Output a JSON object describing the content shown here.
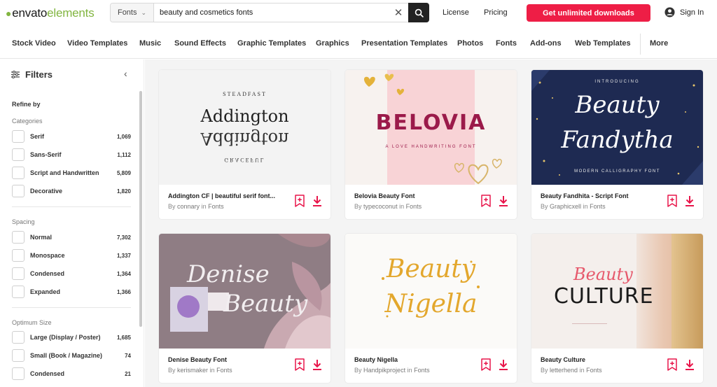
{
  "header": {
    "logo_part1": "envato",
    "logo_part2": "elements",
    "search": {
      "category": "Fonts",
      "value": "beauty and cosmetics fonts",
      "placeholder": "Search"
    },
    "links": [
      "License",
      "Pricing"
    ],
    "cta": "Get unlimited downloads",
    "signin": "Sign In"
  },
  "categories": [
    "Stock Video",
    "Video Templates",
    "Music",
    "Sound Effects",
    "Graphic Templates",
    "Graphics",
    "Presentation Templates",
    "Photos",
    "Fonts",
    "Add-ons",
    "Web Templates",
    "More"
  ],
  "sidebar": {
    "title": "Filters",
    "refine": "Refine by",
    "sections": [
      {
        "title": "Categories",
        "items": [
          {
            "label": "Serif",
            "count": "1,069"
          },
          {
            "label": "Sans-Serif",
            "count": "1,112"
          },
          {
            "label": "Script and Handwritten",
            "count": "5,809"
          },
          {
            "label": "Decorative",
            "count": "1,820"
          }
        ]
      },
      {
        "title": "Spacing",
        "items": [
          {
            "label": "Normal",
            "count": "7,302"
          },
          {
            "label": "Monospace",
            "count": "1,337"
          },
          {
            "label": "Condensed",
            "count": "1,364"
          },
          {
            "label": "Expanded",
            "count": "1,366"
          }
        ]
      },
      {
        "title": "Optimum Size",
        "items": [
          {
            "label": "Large (Display / Poster)",
            "count": "1,685"
          },
          {
            "label": "Small (Book / Magazine)",
            "count": "74"
          },
          {
            "label": "Condensed",
            "count": "21"
          }
        ]
      }
    ]
  },
  "cards": [
    {
      "title": "Addington CF | beautiful serif font...",
      "by_prefix": "By",
      "author": "connary",
      "in_word": "in",
      "category": "Fonts",
      "preview": {
        "top": "STEADFAST",
        "main": "Addington",
        "bottom": "GRACEFUL"
      }
    },
    {
      "title": "Belovia Beauty Font",
      "by_prefix": "By",
      "author": "typecoconut",
      "in_word": "in",
      "category": "Fonts",
      "preview": {
        "main": "BELOVIA",
        "sub": "A LOVE HANDWRITING FONT"
      }
    },
    {
      "title": "Beauty Fandhita - Script Font",
      "by_prefix": "By",
      "author": "Graphicxell",
      "in_word": "in",
      "category": "Fonts",
      "preview": {
        "intro": "INTRODUCING",
        "line1": "Beauty",
        "line2": "Fandytha",
        "sub": "MODERN CALLIGRAPHY FONT"
      }
    },
    {
      "title": "Denise Beauty Font",
      "by_prefix": "By",
      "author": "kerismaker",
      "in_word": "in",
      "category": "Fonts",
      "preview": {
        "line1": "Denise",
        "line2": "Beauty"
      }
    },
    {
      "title": "Beauty Nigella",
      "by_prefix": "By",
      "author": "Handpikproject",
      "in_word": "in",
      "category": "Fonts",
      "preview": {
        "line1": "Beauty",
        "line2": "Nigella"
      }
    },
    {
      "title": "Beauty Culture",
      "by_prefix": "By",
      "author": "letterhend",
      "in_word": "in",
      "category": "Fonts",
      "preview": {
        "script": "Beauty",
        "caps": "CULTURE"
      }
    }
  ],
  "colors": {
    "brand_green": "#82b541",
    "cta_red": "#ee1e46",
    "action_pink": "#e8154a"
  },
  "icons": [
    "search-icon",
    "clear-icon",
    "chevron-down-icon",
    "user-icon",
    "filter-icon",
    "chevron-left-icon",
    "bookmark-add-icon",
    "download-icon"
  ]
}
